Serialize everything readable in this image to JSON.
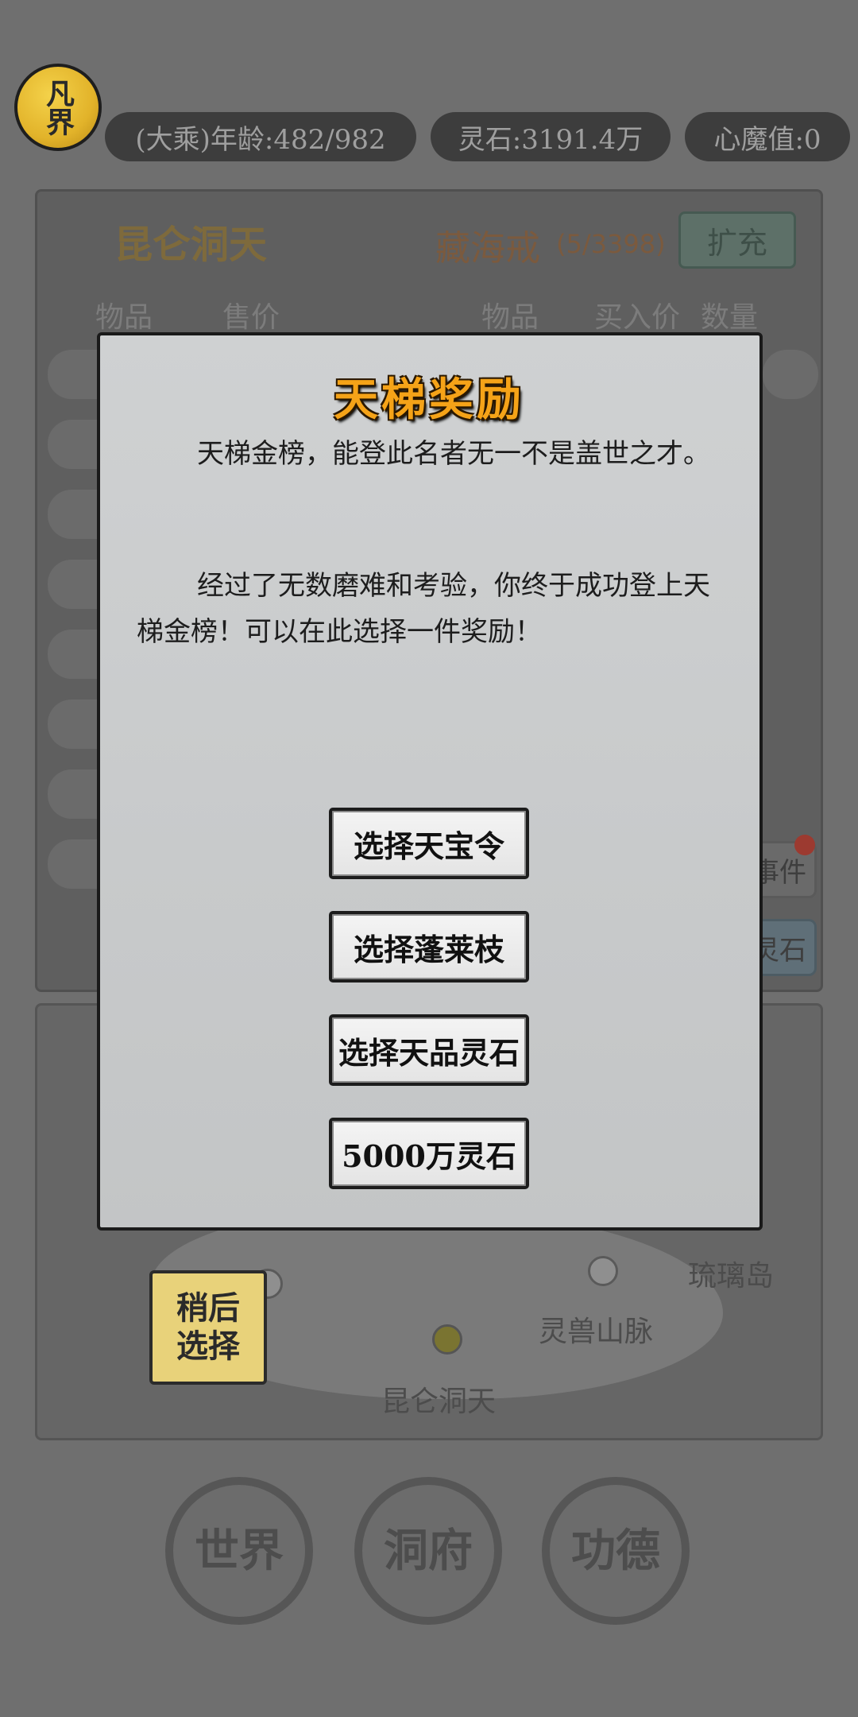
{
  "status": {
    "realm_badge": "凡界",
    "age": "(大乘)年龄:482/982",
    "spirit_stones": "灵石:3191.4万",
    "heart_demon": "心魔值:0"
  },
  "trade": {
    "location": "昆仑洞天",
    "ring_name": "藏海戒",
    "ring_capacity": "(5/3398)",
    "expand_label": "扩充",
    "left_headers": [
      "物品",
      "售价"
    ],
    "right_headers": [
      "物品",
      "买入价",
      "数量"
    ],
    "side_buttons": [
      "事件",
      "灵石"
    ]
  },
  "map": {
    "places": [
      "琉璃岛",
      "灵兽山脉",
      "昆仑洞天"
    ],
    "later_button": "稍后\n选择"
  },
  "nav": {
    "items": [
      "世界",
      "洞府",
      "功德"
    ]
  },
  "modal": {
    "title": "天梯奖励",
    "paragraph1": "天梯金榜，能登此名者无一不是盖世之才。",
    "paragraph2": "经过了无数磨难和考验，你终于成功登上天梯金榜！可以在此选择一件奖励！",
    "choices": [
      "选择天宝令",
      "选择蓬莱枝",
      "选择天品灵石",
      "5000万灵石"
    ]
  }
}
